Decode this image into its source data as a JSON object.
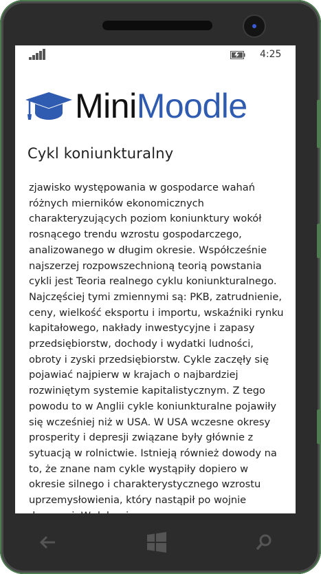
{
  "status_bar": {
    "signal_icon": "signal-strength-icon",
    "battery_icon": "battery-charging-icon",
    "time": "4:25"
  },
  "header": {
    "logo_icon": "graduation-cap-icon",
    "logo_part1": "Mini",
    "logo_part2": "Moodle",
    "colors": {
      "brand_blue": "#2f5bb0",
      "brand_black": "#111111"
    }
  },
  "content": {
    "title": "Cykl koniunkturalny",
    "body": "zjawisko występowania w gospodarce wahań różnych mierników ekonomicznych charakteryzujących poziom koniunktury wokół rosnącego trendu wzrostu gospodarczego, analizowanego w długim okresie. Współcześnie najszerzej rozpowszechnioną teorią powstania cykli jest Teoria realnego cyklu koniunkturalnego. Najczęściej tymi zmiennymi są: PKB, zatrudnienie, ceny, wielkość eksportu i importu, wskaźniki rynku kapitałowego, nakłady inwestycyjne i zapasy przedsiębiorstw, dochody i wydatki ludności, obroty i zyski przedsiębiorstw. Cykle zaczęły się pojawiać najpierw w krajach o najbardziej rozwiniętym systemie kapitalistycznym. Z tego powodu to w Anglii cykle koniunkturalne pojawiły się wcześniej niż w USA. W USA wczesne okresy prosperity i depresji związane były głównie z sytuacją w rolnictwie. Istnieją również dowody na to, że znane nam cykle wystąpiły dopiero w okresie silnego i charakterystycznego wzrostu uprzemysłowienia, który nastąpił po wojnie domowej. W dalszej"
  },
  "navbar": {
    "back_icon": "back-arrow-icon",
    "start_icon": "windows-start-icon",
    "search_icon": "search-icon"
  }
}
